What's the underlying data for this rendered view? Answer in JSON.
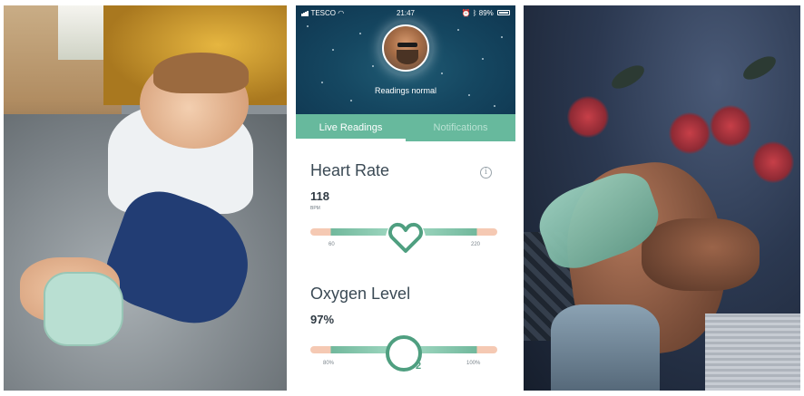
{
  "status_bar": {
    "carrier": "TESCO",
    "time": "21:47",
    "battery": "89%"
  },
  "header": {
    "status_text": "Readings normal"
  },
  "tabs": [
    {
      "label": "Live Readings",
      "active": true
    },
    {
      "label": "Notifications",
      "active": false
    }
  ],
  "heart_rate": {
    "title": "Heart Rate",
    "value": "118",
    "unit": "BPM",
    "min_label": "60",
    "max_label": "220",
    "info_glyph": "i"
  },
  "oxygen": {
    "title": "Oxygen Level",
    "value": "97%",
    "min_label": "80%",
    "max_label": "100%",
    "subscript": "2"
  },
  "colors": {
    "accent": "#67b99d",
    "header_bg": "#154761",
    "range_warning": "#f5c9b3"
  },
  "icons": [
    "signal-icon",
    "wifi-icon",
    "alarm-icon",
    "bluetooth-icon",
    "battery-icon",
    "info-icon",
    "heart-icon",
    "o2-icon"
  ]
}
